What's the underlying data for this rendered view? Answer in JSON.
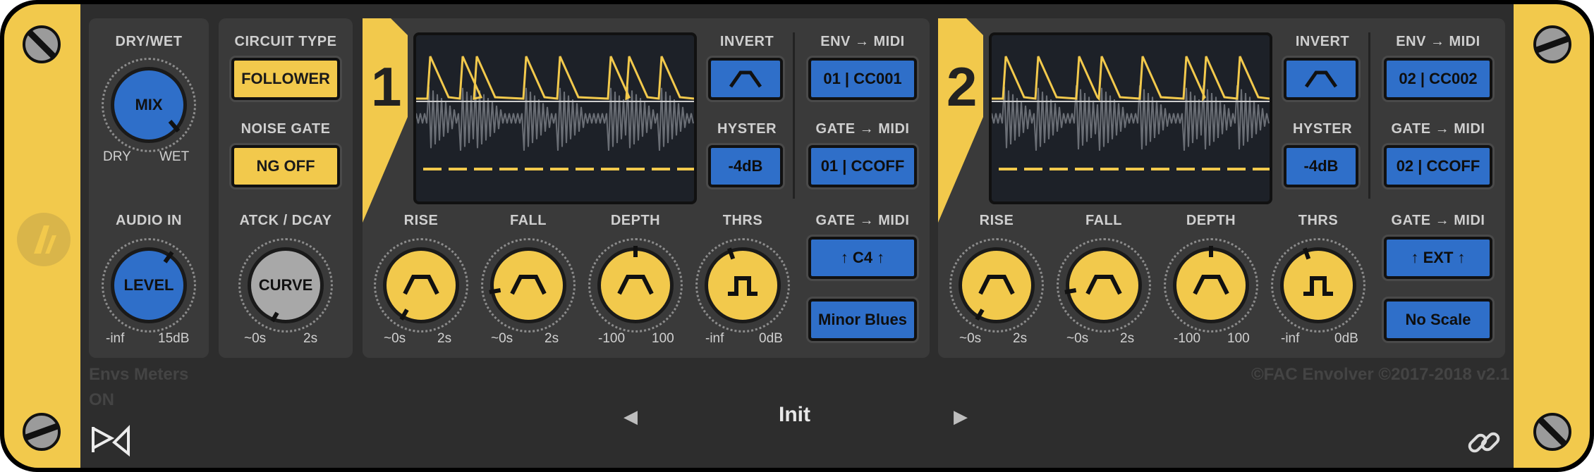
{
  "global": {
    "dry_wet_label": "DRY/WET",
    "mix_label": "MIX",
    "dry_label": "DRY",
    "wet_label": "WET",
    "audio_in_label": "AUDIO IN",
    "level_label": "LEVEL",
    "level_min": "-inf",
    "level_max": "15dB",
    "circuit_type_label": "CIRCUIT TYPE",
    "circuit_type_value": "FOLLOWER",
    "noise_gate_label": "NOISE GATE",
    "noise_gate_value": "NG OFF",
    "atck_dcay_label": "ATCK / DCAY",
    "curve_label": "CURVE",
    "curve_min": "~0s",
    "curve_max": "2s"
  },
  "channels": [
    {
      "number": "1",
      "invert_label": "INVERT",
      "hyster_label": "HYSTER",
      "hyster_value": "-4dB",
      "env_midi_label": "ENV → MIDI",
      "env_midi_value": "01 | CC001",
      "gate_midi_label": "GATE → MIDI",
      "gate_midi_value": "01 | CCOFF",
      "gate_midi_label2": "GATE → MIDI",
      "note_value": "↑ C4 ↑",
      "scale_value": "Minor Blues",
      "knobs": [
        {
          "label": "RISE",
          "min": "~0s",
          "max": "2s"
        },
        {
          "label": "FALL",
          "min": "~0s",
          "max": "2s"
        },
        {
          "label": "DEPTH",
          "min": "-100",
          "max": "100"
        },
        {
          "label": "THRS",
          "min": "-inf",
          "max": "0dB"
        }
      ]
    },
    {
      "number": "2",
      "invert_label": "INVERT",
      "hyster_label": "HYSTER",
      "hyster_value": "-4dB",
      "env_midi_label": "ENV → MIDI",
      "env_midi_value": "02 | CC002",
      "gate_midi_label": "GATE → MIDI",
      "gate_midi_value": "02 | CCOFF",
      "gate_midi_label2": "GATE → MIDI",
      "note_value": "↑ EXT ↑",
      "scale_value": "No Scale",
      "knobs": [
        {
          "label": "RISE",
          "min": "~0s",
          "max": "2s"
        },
        {
          "label": "FALL",
          "min": "~0s",
          "max": "2s"
        },
        {
          "label": "DEPTH",
          "min": "-100",
          "max": "100"
        },
        {
          "label": "THRS",
          "min": "-inf",
          "max": "0dB"
        }
      ]
    }
  ],
  "footer": {
    "envs_meters": "Envs Meters",
    "envs_meters_state": "ON",
    "preset_name": "Init",
    "copyright": "©FAC Envolver ©2017-2018 v2.1",
    "prev_icon": "triangle-left-icon",
    "next_icon": "triangle-right-icon"
  },
  "colors": {
    "accent_yellow": "#f2c94c",
    "accent_blue": "#2f6fc9",
    "panel": "#3a3a3a"
  }
}
